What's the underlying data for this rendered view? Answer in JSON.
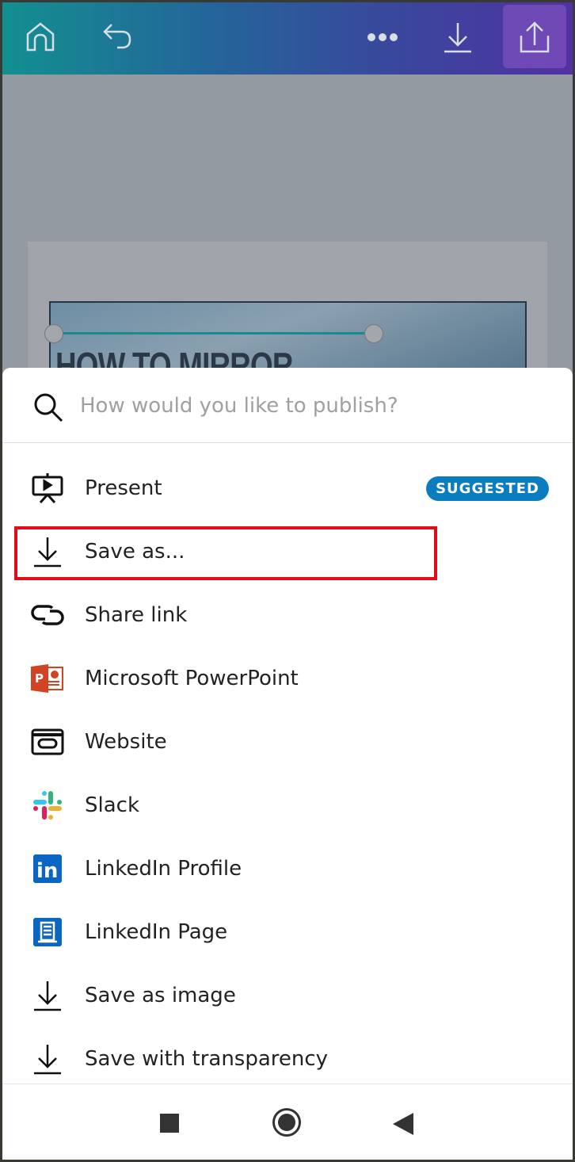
{
  "toolbar": {
    "home": "home-icon",
    "undo": "undo-icon",
    "more": "more-icon",
    "download": "download-icon",
    "share": "share-icon"
  },
  "canvas": {
    "headline": "HOW TO MIRROR"
  },
  "search": {
    "placeholder": "How would you like to publish?"
  },
  "items": [
    {
      "label": "Present",
      "icon": "present-icon",
      "badge": "SUGGESTED"
    },
    {
      "label": "Save as...",
      "icon": "download-icon",
      "highlighted": true
    },
    {
      "label": "Share link",
      "icon": "link-icon"
    },
    {
      "label": "Microsoft PowerPoint",
      "icon": "powerpoint-icon"
    },
    {
      "label": "Website",
      "icon": "website-icon"
    },
    {
      "label": "Slack",
      "icon": "slack-icon"
    },
    {
      "label": "LinkedIn Profile",
      "icon": "linkedin-icon"
    },
    {
      "label": "LinkedIn Page",
      "icon": "linkedin-page-icon"
    },
    {
      "label": "Save as image",
      "icon": "download-icon"
    },
    {
      "label": "Save with transparency",
      "icon": "download-icon"
    }
  ],
  "colors": {
    "badge": "#0a7cc0",
    "highlight": "#e30b17",
    "linkedin": "#0a66c2",
    "powerpoint": "#d04423"
  }
}
